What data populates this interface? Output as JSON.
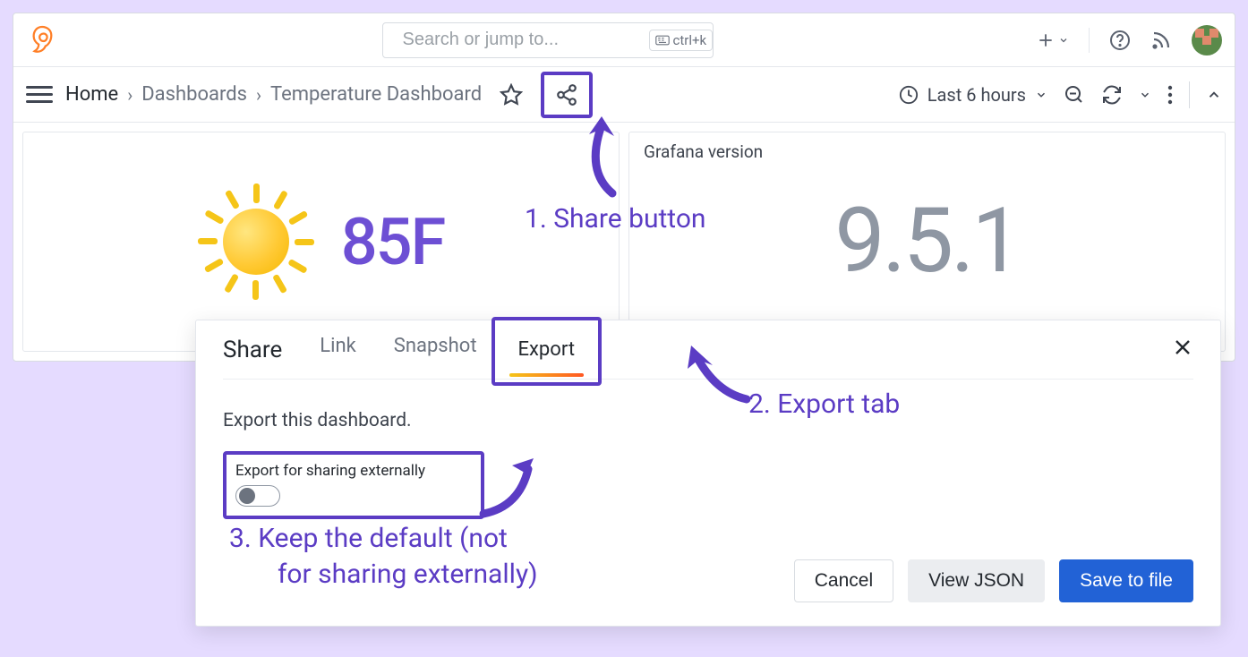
{
  "topbar": {
    "search_placeholder": "Search or jump to...",
    "search_kbd": "ctrl+k"
  },
  "breadcrumb": {
    "items": [
      "Home",
      "Dashboards",
      "Temperature Dashboard"
    ]
  },
  "toolbar": {
    "time_range": "Last 6 hours"
  },
  "panels": {
    "temp": {
      "value": "85F"
    },
    "version": {
      "title": "Grafana version",
      "value": "9.5.1"
    }
  },
  "modal": {
    "title": "Share",
    "tabs": {
      "link": "Link",
      "snapshot": "Snapshot",
      "export": "Export"
    },
    "active_tab": "export",
    "description": "Export this dashboard.",
    "toggle_label": "Export for sharing externally",
    "toggle_on": false,
    "buttons": {
      "cancel": "Cancel",
      "view_json": "View JSON",
      "save": "Save to file"
    }
  },
  "annotations": {
    "a1": "1.  Share button",
    "a2": "2.  Export tab",
    "a3_line1": "3.  Keep the default (not",
    "a3_line2": "for sharing externally)"
  }
}
